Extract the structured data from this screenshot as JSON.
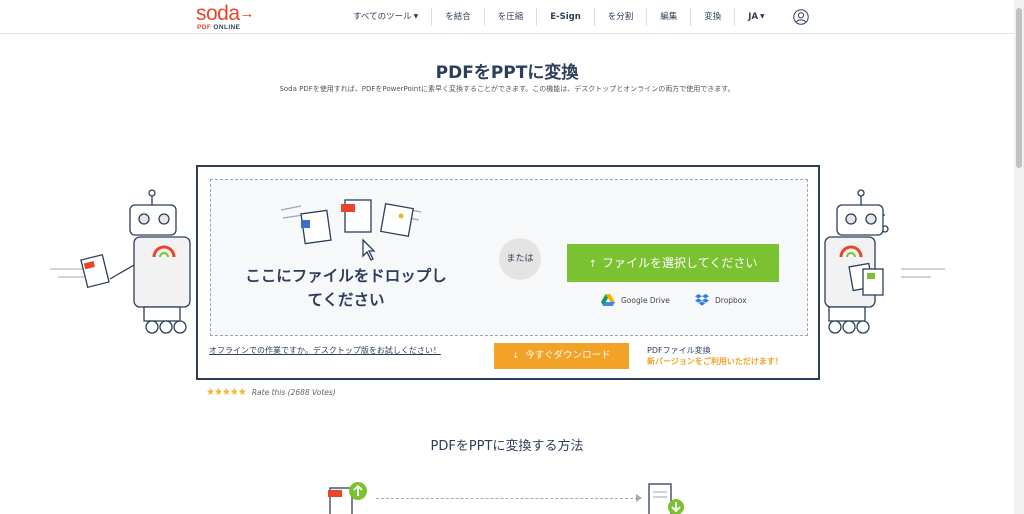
{
  "logo": {
    "main": "soda",
    "sub_brand": "PDF",
    "sub_rest": " ONLINE"
  },
  "nav": {
    "items": [
      {
        "label": "すべてのツール",
        "dropdown": true,
        "bold": false
      },
      {
        "label": "を結合",
        "dropdown": false,
        "bold": false
      },
      {
        "label": "を圧縮",
        "dropdown": false,
        "bold": false
      },
      {
        "label": "E-Sign",
        "dropdown": false,
        "bold": true
      },
      {
        "label": "を分割",
        "dropdown": false,
        "bold": false
      },
      {
        "label": "編集",
        "dropdown": false,
        "bold": false
      },
      {
        "label": "変換",
        "dropdown": false,
        "bold": false
      },
      {
        "label": "JA",
        "dropdown": true,
        "bold": true
      }
    ]
  },
  "hero": {
    "title": "PDFをPPTに変換",
    "subtitle": "Soda PDFを使用すれば、PDFをPowerPointに素早く変換することができます。この機能は、デスクトップとオンラインの両方で使用できます。"
  },
  "converter": {
    "drop_text": "ここにファイルをドロップしてください",
    "or_label": "または",
    "choose_button": "ファイルを選択してください",
    "google_drive": "Google Drive",
    "dropbox": "Dropbox",
    "offline_link": "オフラインでの作業ですか。デスクトップ版をお試しください！",
    "download_button": "今すぐダウンロード",
    "promo_line1": "PDFファイル変換",
    "promo_line2": "新バージョンをご利用いただけます！"
  },
  "rating": {
    "stars": 5,
    "text": "Rate this (2688 Votes)"
  },
  "howto": {
    "title": "PDFをPPTに変換する方法"
  },
  "colors": {
    "brand": "#e8452c",
    "navy": "#2c3e5a",
    "green": "#7ac231",
    "orange": "#f1a227"
  }
}
